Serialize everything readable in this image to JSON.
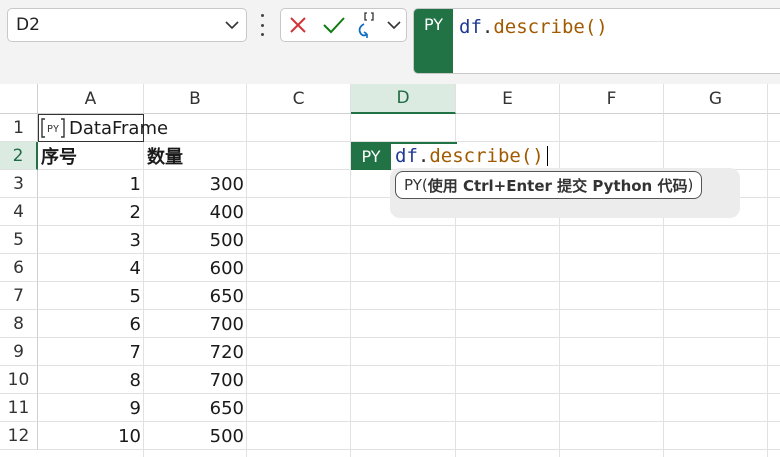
{
  "name_box": {
    "value": "D2"
  },
  "formula_bar": {
    "py_label": "PY",
    "tokens": {
      "var": "df",
      "dot": ".",
      "fn": "describe",
      "parens": "()"
    }
  },
  "columns": [
    "A",
    "B",
    "C",
    "D",
    "E",
    "F",
    "G"
  ],
  "active_column": "D",
  "rows": [
    "1",
    "2",
    "3",
    "4",
    "5",
    "6",
    "7",
    "8",
    "9",
    "10",
    "11",
    "12"
  ],
  "active_row": "2",
  "cells": {
    "a1": "DataFrame",
    "a1_icon": "python-icon",
    "a2": "序号",
    "b2": "数量",
    "col_a": [
      "1",
      "2",
      "3",
      "4",
      "5",
      "6",
      "7",
      "8",
      "9",
      "10"
    ],
    "col_b": [
      "300",
      "400",
      "500",
      "600",
      "650",
      "700",
      "720",
      "700",
      "650",
      "500"
    ]
  },
  "editing_cell": {
    "py_label": "PY",
    "tokens": {
      "var": "df",
      "dot": ".",
      "fn": "describe",
      "parens": "()"
    }
  },
  "tooltip": {
    "prefix": "PY(",
    "bold": "使用 Ctrl+Enter 提交 Python 代码",
    "suffix": ")"
  },
  "colors": {
    "accent": "#217346",
    "cancel": "#d13438",
    "confirm": "#107c10",
    "insert_fn": "#0f6cbd"
  }
}
